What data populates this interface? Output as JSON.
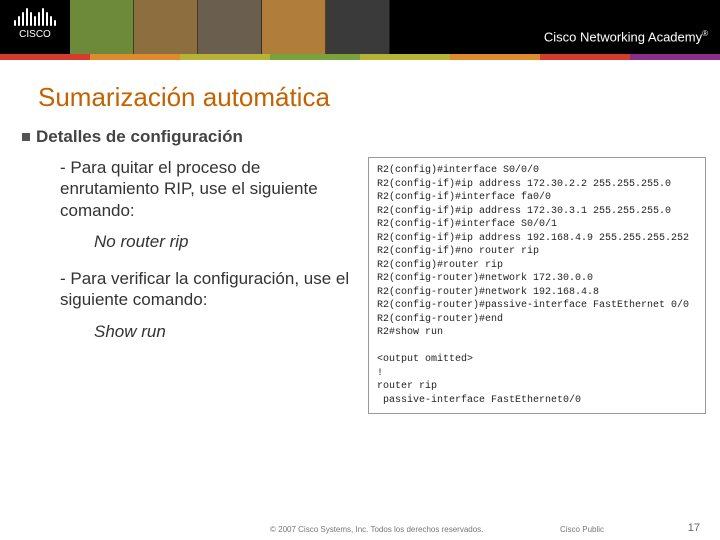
{
  "banner": {
    "logo_text": "CISCO",
    "academy": "Cisco Networking Academy",
    "reg": "®",
    "faces_colors": [
      "#6d8a3a",
      "#8d6f3f",
      "#6a5e4f",
      "#b07d3a",
      "#3a3a3a"
    ],
    "band_colors": [
      "#d63c2c",
      "#e08a2e",
      "#b7b335",
      "#7aa23a",
      "#b7b335",
      "#e08a2e",
      "#d63c2c",
      "#8a2e8a"
    ]
  },
  "slide": {
    "title": "Sumarización automática",
    "subtitle": "Detalles de configuración",
    "para1_prefix": "- ",
    "para1": "Para quitar el proceso de enrutamiento RIP, use el siguiente comando:",
    "cmd1": "No router rip",
    "para2_prefix": "- ",
    "para2": "Para verificar la configuración, use el siguiente comando:",
    "cmd2": "Show run"
  },
  "cli": {
    "lines": [
      "R2(config)#interface S0/0/0",
      "R2(config-if)#ip address 172.30.2.2 255.255.255.0",
      "R2(config-if)#interface fa0/0",
      "R2(config-if)#ip address 172.30.3.1 255.255.255.0",
      "R2(config-if)#interface S0/0/1",
      "R2(config-if)#ip address 192.168.4.9 255.255.255.252",
      "R2(config-if)#no router rip",
      "R2(config)#router rip",
      "R2(config-router)#network 172.30.0.0",
      "R2(config-router)#network 192.168.4.8",
      "R2(config-router)#passive-interface FastEthernet 0/0",
      "R2(config-router)#end",
      "R2#show run",
      "",
      "<output omitted>",
      "!",
      "router rip",
      " passive-interface FastEthernet0/0"
    ]
  },
  "footer": {
    "copyright": "© 2007 Cisco Systems, Inc. Todos los derechos reservados.",
    "public": "Cisco Public",
    "page": "17"
  },
  "logo_bar_heights": [
    6,
    10,
    14,
    18,
    14,
    10,
    14,
    18,
    14,
    10,
    6
  ]
}
